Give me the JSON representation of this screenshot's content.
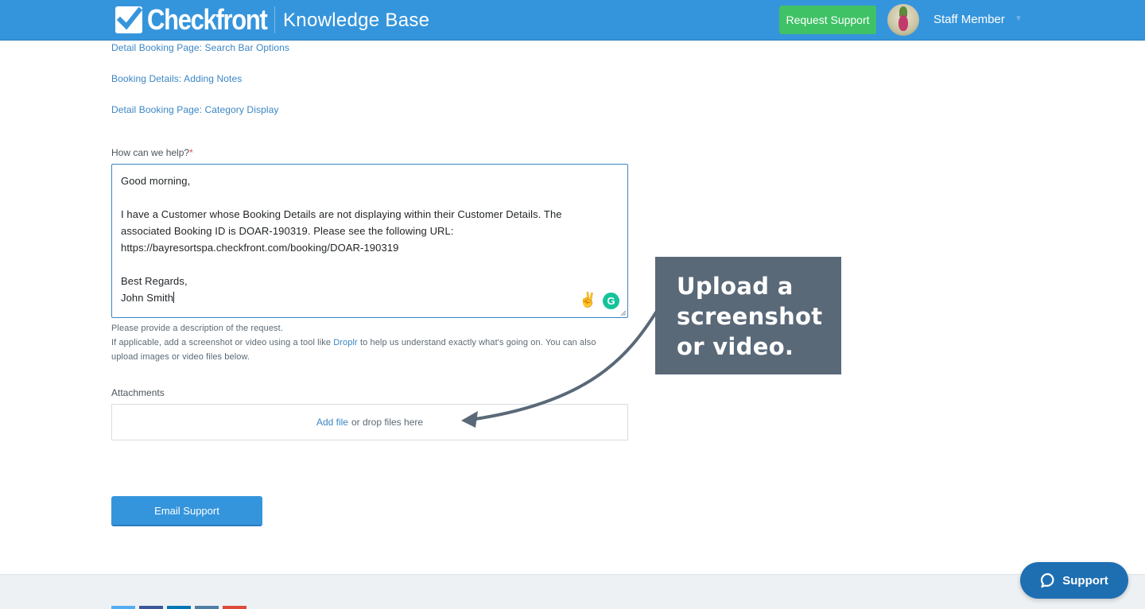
{
  "header": {
    "logo_text": "Checkfront",
    "title": "Knowledge Base",
    "request_support_label": "Request Support",
    "user_name": "Staff Member",
    "colors": {
      "header_bg": "#3595dc",
      "request_btn": "#3fc266"
    }
  },
  "related_links": [
    "Detail Booking Page: Search Bar Options",
    "Booking Details: Adding Notes",
    "Detail Booking Page: Category Display"
  ],
  "form": {
    "help_label": "How can we help?",
    "required_mark": "*",
    "message_lines": [
      "Good morning,",
      "",
      "I have a Customer whose Booking Details are not displaying within their Customer Details. The",
      "associated Booking ID is DOAR-190319. Please see the following URL:",
      "https://bayresortspa.checkfront.com/booking/DOAR-190319",
      "",
      "Best Regards,",
      "John Smith"
    ],
    "help_text_1": "Please provide a description of the request.",
    "help_text_2_prefix": "If applicable, add a screenshot or video using a tool like ",
    "help_text_2_link": "Droplr",
    "help_text_2_suffix": " to help us understand exactly what's going on. You can also",
    "help_text_3": "upload images or video files below.",
    "attachments_label": "Attachments",
    "add_file_label": "Add file",
    "drop_label": "or drop files here",
    "submit_label": "Email Support"
  },
  "annotation": {
    "lines": [
      "Upload a",
      "screenshot",
      "or video."
    ],
    "color": "#5a6978"
  },
  "support_widget": {
    "label": "Support"
  },
  "footer": {
    "social_colors": [
      "#55acee",
      "#3b5998",
      "#0077b5",
      "#517fa4",
      "#dd4b39"
    ]
  }
}
